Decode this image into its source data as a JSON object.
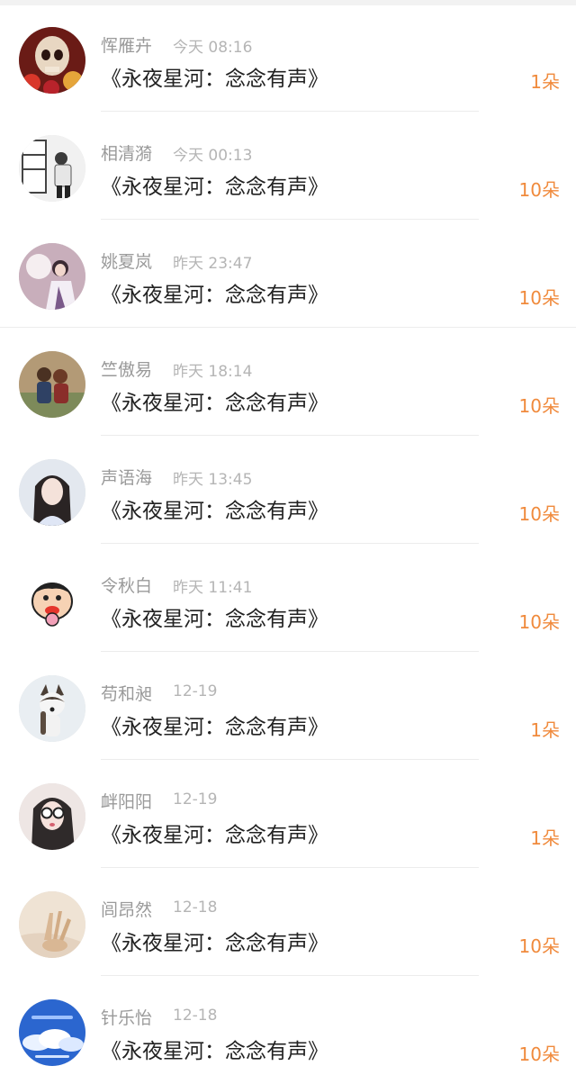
{
  "items": [
    {
      "name": "恽雁卉",
      "time": "今天 08:16",
      "title": "《永夜星河：念念有声》",
      "amount": "1朵",
      "avatar": "skull-avatar-icon",
      "colors": [
        "#7a1f1a",
        "#e8d7c2"
      ]
    },
    {
      "name": "相清漪",
      "time": "今天 00:13",
      "title": "《永夜星河：念念有声》",
      "amount": "10朵",
      "avatar": "person-window-avatar-icon",
      "colors": [
        "#f2f2f2",
        "#3b3b3b"
      ]
    },
    {
      "name": "姚夏岚",
      "time": "昨天 23:47",
      "title": "《永夜星河：念念有声》",
      "amount": "10朵",
      "avatar": "costume-couple-avatar-icon",
      "colors": [
        "#c9a9b5",
        "#5b3e4f"
      ]
    },
    {
      "name": "竺傲易",
      "time": "昨天 18:14",
      "title": "《永夜星河：念念有声》",
      "amount": "10朵",
      "avatar": "couple-outdoor-avatar-icon",
      "colors": [
        "#a58a6a",
        "#3c4b6b"
      ]
    },
    {
      "name": "声语海",
      "time": "昨天 13:45",
      "title": "《永夜星河：念念有声》",
      "amount": "10朵",
      "avatar": "girl-portrait-avatar-icon",
      "colors": [
        "#dfe6f0",
        "#2a2a2a"
      ]
    },
    {
      "name": "令秋白",
      "time": "昨天 11:41",
      "title": "《永夜星河：念念有声》",
      "amount": "10朵",
      "avatar": "cartoon-boy-avatar-icon",
      "colors": [
        "#ffffff",
        "#e5352b"
      ]
    },
    {
      "name": "苟和昶",
      "time": "12-19",
      "title": "《永夜星河：念念有声》",
      "amount": "1朵",
      "avatar": "husky-dog-avatar-icon",
      "colors": [
        "#e9edf1",
        "#6b5a4a"
      ]
    },
    {
      "name": "衅阳阳",
      "time": "12-19",
      "title": "《永夜星河：念念有声》",
      "amount": "1朵",
      "avatar": "sunglasses-girl-avatar-icon",
      "colors": [
        "#f0e8e6",
        "#2e2a2a"
      ]
    },
    {
      "name": "闾昂然",
      "time": "12-18",
      "title": "《永夜星河：念念有声》",
      "amount": "10朵",
      "avatar": "soft-hand-avatar-icon",
      "colors": [
        "#efe3d6",
        "#c7a886"
      ]
    },
    {
      "name": "针乐怡",
      "time": "12-18",
      "title": "《永夜星河：念念有声》",
      "amount": "10朵",
      "avatar": "blue-sky-avatar-icon",
      "colors": [
        "#2f6fd6",
        "#e9f1ff"
      ]
    }
  ]
}
